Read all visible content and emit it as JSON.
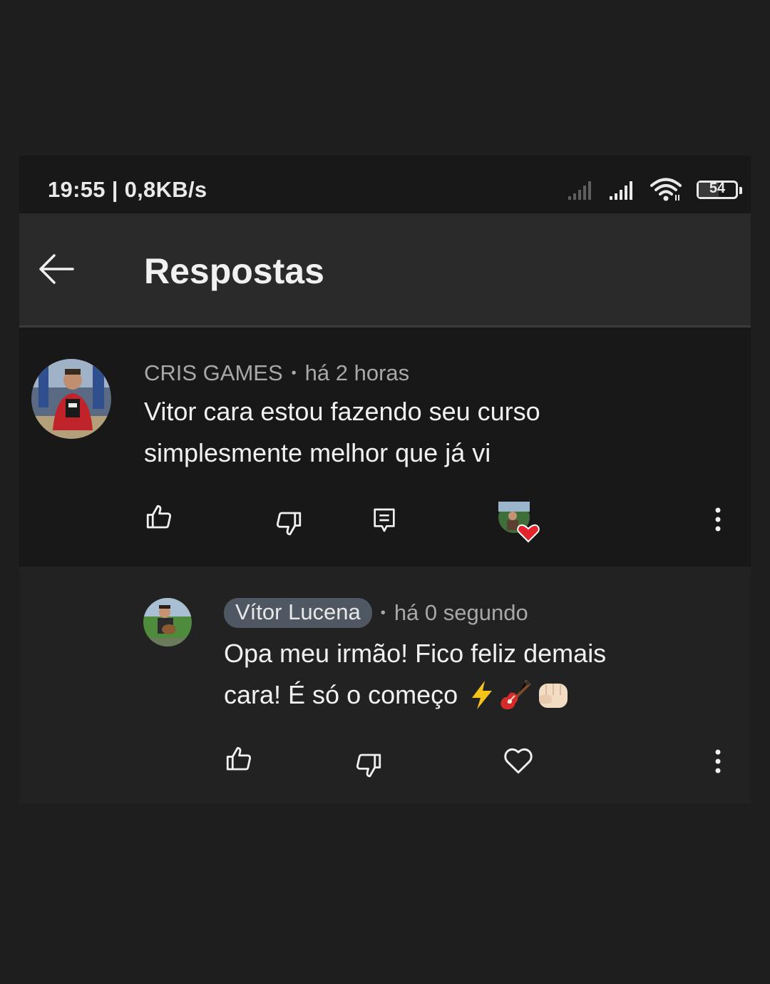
{
  "status_bar": {
    "text": "19:55 | 0,8KB/s",
    "battery": "54",
    "battery_level": 0.54
  },
  "header": {
    "title": "Respostas"
  },
  "comment": {
    "author": "CRIS GAMES",
    "separator": "•",
    "time": "há 2 horas",
    "line1": "Vitor cara estou fazendo seu curso",
    "line2": "simplesmente melhor que já vi"
  },
  "reply": {
    "author": "Vítor Lucena",
    "separator": "•",
    "time": "há 0 segundo",
    "line1": "Opa meu irmão! Fico feliz demais",
    "line2": "cara! É só o começo"
  },
  "colors": {
    "background": "#1e1e1f",
    "header": "#2a2a2a",
    "reply_background": "#222222",
    "heart_red": "#e3242b",
    "author_chip": "#4f5862"
  },
  "icons": [
    "back-arrow-icon",
    "signal-icon",
    "wifi-icon",
    "battery-icon",
    "thumbs-up-icon",
    "thumbs-down-icon",
    "reply-icon",
    "creator-heart-icon",
    "more-vert-icon",
    "heart-outline-icon",
    "lightning-emoji",
    "guitar-emoji",
    "fist-emoji"
  ]
}
